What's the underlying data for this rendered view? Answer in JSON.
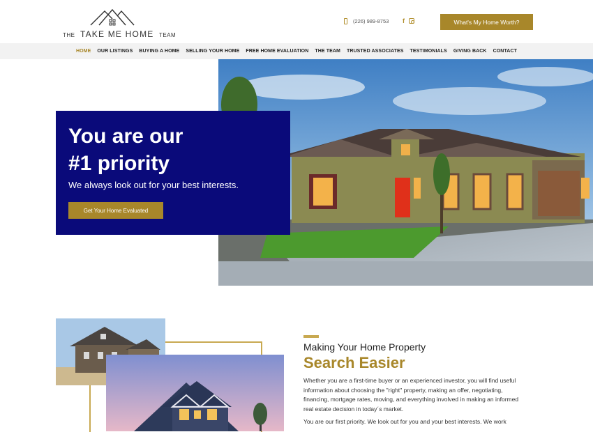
{
  "header": {
    "logo": {
      "the_left": "THE",
      "main": "TAKE ME HOME",
      "team": "TEAM"
    },
    "phone": "(226) 989-8753",
    "social": {
      "facebook": "f"
    },
    "cta": "What's My Home Worth?"
  },
  "nav": {
    "items": [
      {
        "label": "HOME"
      },
      {
        "label": "OUR LISTINGS"
      },
      {
        "label": "BUYING A HOME"
      },
      {
        "label": "SELLING YOUR HOME"
      },
      {
        "label": "FREE HOME EVALUATION"
      },
      {
        "label": "THE TEAM"
      },
      {
        "label": "TRUSTED ASSOCIATES"
      },
      {
        "label": "TESTIMONIALS"
      },
      {
        "label": "GIVING BACK"
      },
      {
        "label": "CONTACT"
      }
    ],
    "active": "HOME"
  },
  "hero": {
    "title_line1": "You are our",
    "title_line2": "#1 priority",
    "subtitle": "We always look out for your best interests.",
    "button": "Get Your Home Evaluated"
  },
  "section2": {
    "kicker": "Making Your Home Property",
    "title": "Search Easier",
    "body": "Whether you are a first-time buyer or an experienced investor, you will find useful information about choosing the \"right\" property, making an offer, negotiating, financing, mortgage rates, moving, and everything involved in making an informed real estate decision in today´s market.",
    "body2": "You are our first priority. We look out for you and your best interests. We work"
  },
  "colors": {
    "gold": "#a8872a",
    "navy": "#0a0a7a",
    "nav_bg": "#f2f2f2"
  },
  "icons": [
    "house-logo-icon",
    "phone-icon",
    "facebook-icon",
    "instagram-icon"
  ]
}
